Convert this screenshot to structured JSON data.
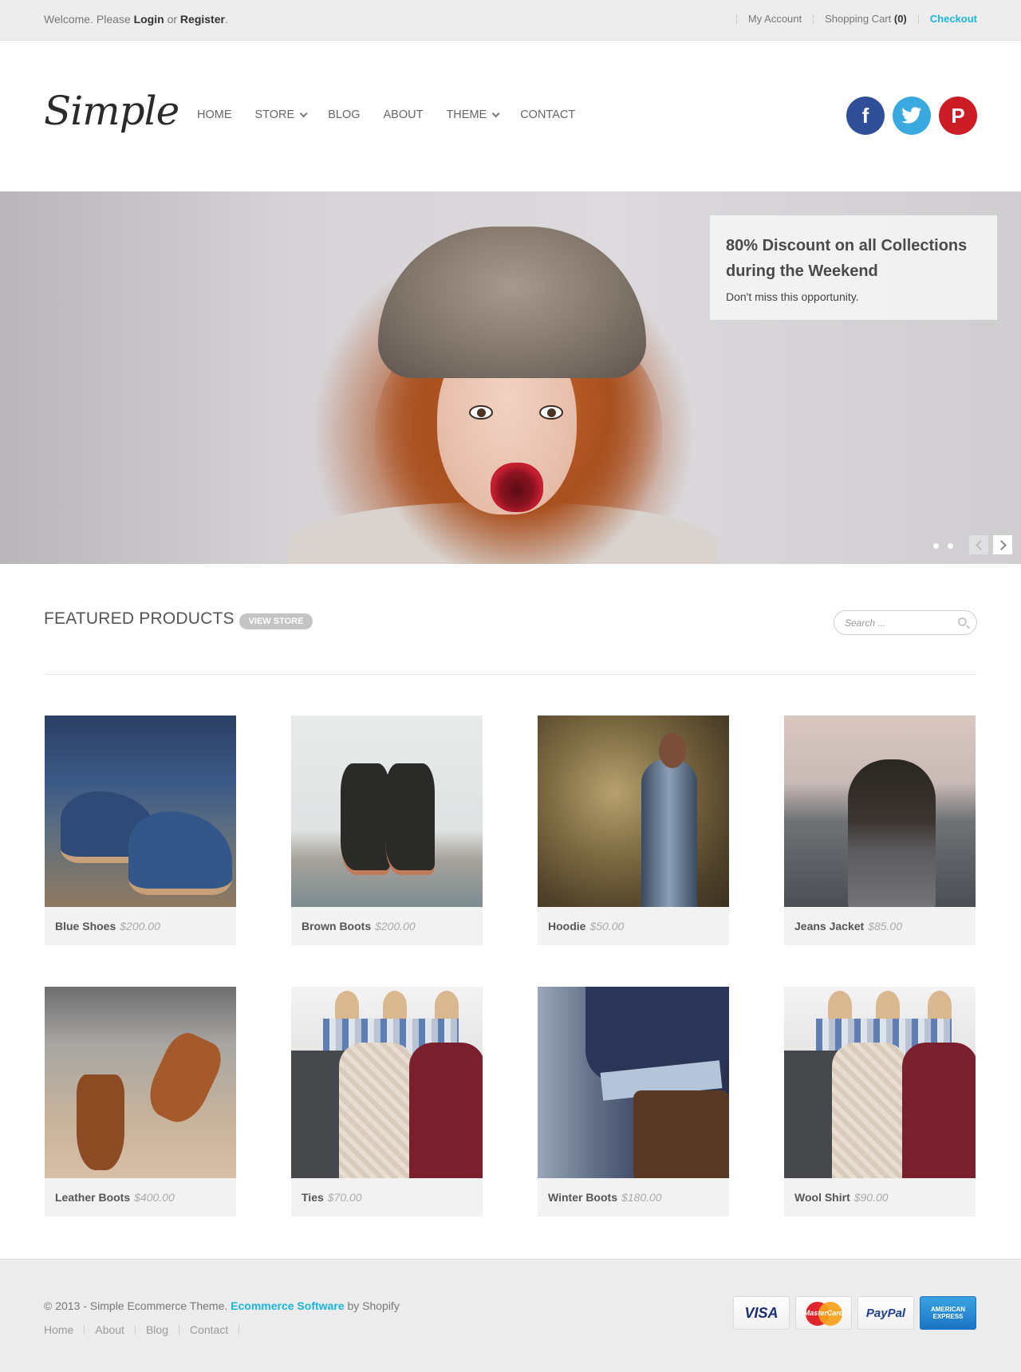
{
  "topbar": {
    "welcome_pre": "Welcome. Please ",
    "login": "Login",
    "or": " or ",
    "register": "Register",
    "period": ".",
    "my_account": "My Account",
    "cart_label": "Shopping Cart",
    "cart_count": "(0)",
    "checkout": "Checkout"
  },
  "header": {
    "logo": "Simple",
    "nav": [
      "HOME",
      "STORE",
      "BLOG",
      "ABOUT",
      "THEME",
      "CONTACT"
    ],
    "social": {
      "facebook": "f",
      "twitter": "t",
      "pinterest": "P"
    },
    "colors": {
      "facebook": "#2f4f99",
      "twitter": "#39a9e0",
      "pinterest": "#cc1c26"
    }
  },
  "hero": {
    "promo_title_1": "80% Discount on all Collections",
    "promo_title_2": "during the Weekend",
    "promo_sub": "Don't miss this opportunity.",
    "slide_count": 2
  },
  "featured": {
    "title": "FEATURED PRODUCTS",
    "view_store": "VIEW STORE",
    "search_placeholder": "Search ...",
    "products": [
      {
        "name": "Blue Shoes",
        "price": "$200.00"
      },
      {
        "name": "Brown Boots",
        "price": "$200.00"
      },
      {
        "name": "Hoodie",
        "price": "$50.00"
      },
      {
        "name": "Jeans Jacket",
        "price": "$85.00"
      },
      {
        "name": "Leather Boots",
        "price": "$400.00"
      },
      {
        "name": "Ties",
        "price": "$70.00"
      },
      {
        "name": "Winter Boots",
        "price": "$180.00"
      },
      {
        "name": "Wool Shirt",
        "price": "$90.00"
      }
    ]
  },
  "footer": {
    "copy_pre": "© 2013 - Simple Ecommerce Theme. ",
    "copy_link": "Ecommerce Software",
    "copy_post": " by Shopify",
    "links": [
      "Home",
      "About",
      "Blog",
      "Contact"
    ],
    "payments": {
      "visa": "VISA",
      "mastercard": "MasterCard",
      "paypal": "PayPal",
      "amex": "AMERICAN EXPRESS"
    }
  },
  "accent_color": "#1ab4d6"
}
